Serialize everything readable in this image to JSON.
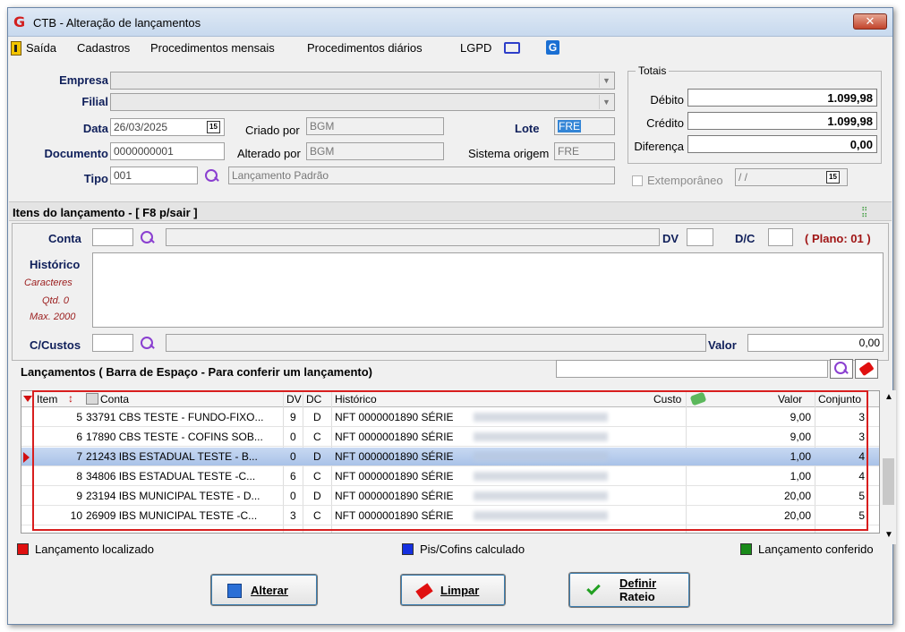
{
  "window": {
    "title": "CTB - Alteração de lançamentos",
    "close_glyph": "✕"
  },
  "menu": {
    "items": [
      "Saída",
      "Cadastros",
      "Procedimentos mensais",
      "Procedimentos diários",
      "LGPD"
    ]
  },
  "header": {
    "empresa_label": "Empresa",
    "filial_label": "Filial",
    "data_label": "Data",
    "data_value": "26/03/2025",
    "criado_label": "Criado por",
    "criado_value": "BGM",
    "lote_label": "Lote",
    "lote_value": "FRE",
    "documento_label": "Documento",
    "documento_value": "0000000001",
    "alterado_label": "Alterado por",
    "alterado_value": "BGM",
    "sistema_label": "Sistema origem",
    "sistema_value": "FRE",
    "tipo_label": "Tipo",
    "tipo_value": "001",
    "tipo_desc": "Lançamento Padrão"
  },
  "totais": {
    "title": "Totais",
    "debito_label": "Débito",
    "debito_value": "1.099,98",
    "credito_label": "Crédito",
    "credito_value": "1.099,98",
    "diferenca_label": "Diferença",
    "diferenca_value": "0,00"
  },
  "extemporaneo": {
    "label": "Extemporâneo",
    "date_value": "/ /"
  },
  "items_section": {
    "title": "Itens do lançamento - [ F8 p/sair ]",
    "conta_label": "Conta",
    "dv_label": "DV",
    "dc_label": "D/C",
    "plano_label": "( Plano: 01 )",
    "historico_label": "Histórico",
    "caracteres_label": "Caracteres",
    "qtd_label": "Qtd. 0",
    "max_label": "Max. 2000",
    "ccustos_label": "C/Custos",
    "valor_label": "Valor",
    "valor_value": "0,00"
  },
  "lancamentos": {
    "title": "Lançamentos ( Barra de Espaço - Para conferir um lançamento)",
    "columns": {
      "item": "Item",
      "conta": "Conta",
      "dv": "DV",
      "dc": "DC",
      "historico": "Histórico",
      "custo": "Custo",
      "valor": "Valor",
      "conjunto": "Conjunto"
    },
    "rows": [
      {
        "item": "5",
        "conta": "33791 CBS TESTE - FUNDO-FIXO...",
        "dv": "9",
        "dc": "D",
        "historico": "NFT 0000001890 SÉRIE",
        "valor": "9,00",
        "conjunto": "3"
      },
      {
        "item": "6",
        "conta": "17890 CBS TESTE - COFINS SOB...",
        "dv": "0",
        "dc": "C",
        "historico": "NFT 0000001890 SÉRIE",
        "valor": "9,00",
        "conjunto": "3"
      },
      {
        "item": "7",
        "conta": "21243 IBS ESTADUAL TESTE - B...",
        "dv": "0",
        "dc": "D",
        "historico": "NFT 0000001890 SÉRIE",
        "valor": "1,00",
        "conjunto": "4"
      },
      {
        "item": "8",
        "conta": "34806 IBS ESTADUAL TESTE -C...",
        "dv": "6",
        "dc": "C",
        "historico": "NFT 0000001890 SÉRIE",
        "valor": "1,00",
        "conjunto": "4"
      },
      {
        "item": "9",
        "conta": "23194 IBS MUNICIPAL TESTE - D...",
        "dv": "0",
        "dc": "D",
        "historico": "NFT 0000001890 SÉRIE",
        "valor": "20,00",
        "conjunto": "5"
      },
      {
        "item": "10",
        "conta": "26909 IBS MUNICIPAL TESTE -C...",
        "dv": "3",
        "dc": "C",
        "historico": "NFT 0000001890 SÉRIE",
        "valor": "20,00",
        "conjunto": "5"
      }
    ]
  },
  "legend": {
    "localizado": "Lançamento localizado",
    "pis_cofins": "Pis/Cofins calculado",
    "conferido": "Lançamento conferido",
    "colors": {
      "localizado": "#e01010",
      "pis_cofins": "#1530e0",
      "conferido": "#1a8a1a",
      "accent": "#d81e1e"
    }
  },
  "buttons": {
    "alterar": "Alterar",
    "limpar": "Limpar",
    "definir_line1": "Definir",
    "definir_line2": "Rateio"
  }
}
